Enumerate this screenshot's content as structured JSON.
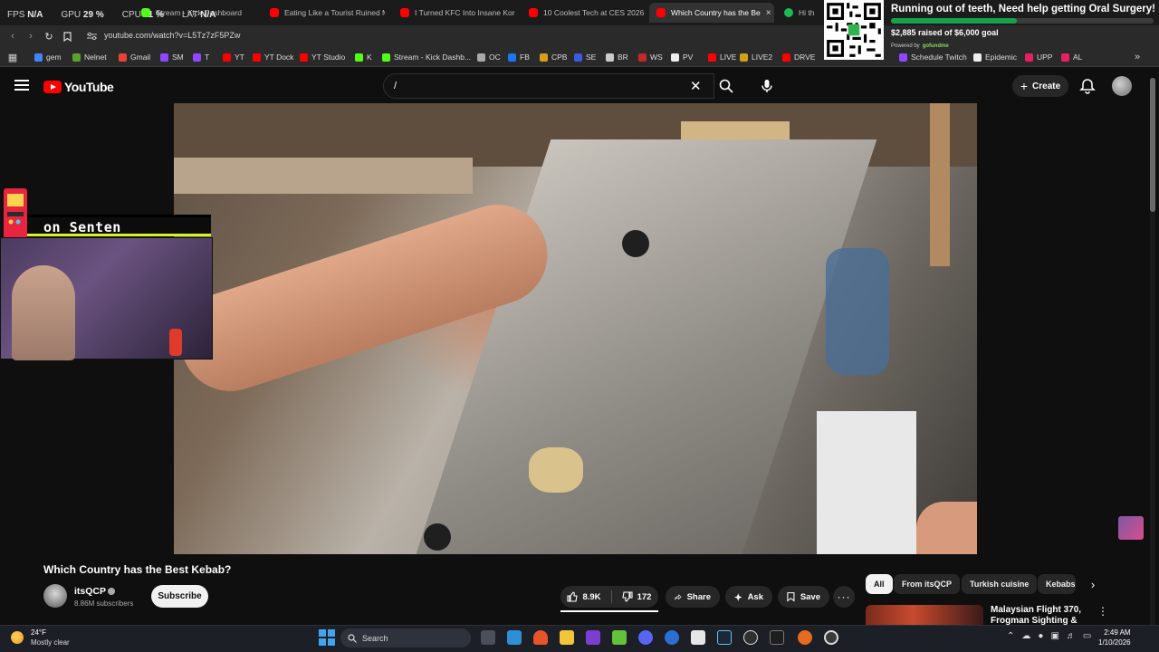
{
  "overlay": {
    "fps_label": "FPS",
    "fps_value": "N/A",
    "gpu_label": "GPU",
    "gpu_value": "29 %",
    "cpu_label": "CPU",
    "cpu_value": "11 %",
    "lat_label": "LAT",
    "lat_value": "N/A"
  },
  "tabs": [
    {
      "label": "Stream - Kick Dashboard",
      "color": "#53fc18"
    },
    {
      "label": "Eating Like a Tourist Ruined My",
      "color": "#ff0000"
    },
    {
      "label": "I Turned KFC Into Insane Korea",
      "color": "#ff0000"
    },
    {
      "label": "10 Coolest Tech at CES 2026 (",
      "color": "#ff0000"
    },
    {
      "label": "Which Country has the Be",
      "color": "#ff0000",
      "close": "×"
    },
    {
      "label": "Hi th",
      "color": "#1db954"
    }
  ],
  "address": {
    "url": "youtube.com/watch?v=L5Tz7zF5PZw"
  },
  "bookmarks": [
    {
      "label": "gem",
      "color": "#4285f4"
    },
    {
      "label": "Nelnet",
      "color": "#5aa02c"
    },
    {
      "label": "Gmail",
      "color": "#ea4335"
    },
    {
      "label": "SM",
      "color": "#9146ff"
    },
    {
      "label": "T",
      "color": "#9146ff"
    },
    {
      "label": "YT",
      "color": "#ff0000"
    },
    {
      "label": "YT Dock",
      "color": "#ff0000"
    },
    {
      "label": "YT Studio",
      "color": "#ff0000"
    },
    {
      "label": "K",
      "color": "#53fc18"
    },
    {
      "label": "Stream - Kick Dashb...",
      "color": "#53fc18"
    },
    {
      "label": "OC",
      "color": "#aaaaaa"
    },
    {
      "label": "FB",
      "color": "#1877f2"
    },
    {
      "label": "CPB",
      "color": "#d4a017"
    },
    {
      "label": "SE",
      "color": "#3b5bdb"
    },
    {
      "label": "BR",
      "color": "#cccccc"
    },
    {
      "label": "WS",
      "color": "#c62828"
    },
    {
      "label": "PV",
      "color": "#eeeeee"
    },
    {
      "label": "LIVE",
      "color": "#ff0000"
    },
    {
      "label": "LIVE2",
      "color": "#d4a017"
    },
    {
      "label": "DRVE",
      "color": "#ff0000"
    },
    {
      "label": "Schedule Twitch",
      "color": "#9146ff"
    },
    {
      "label": "Epidemic",
      "color": "#eeeeee"
    },
    {
      "label": "UPP",
      "color": "#e91e63"
    },
    {
      "label": "AL",
      "color": "#e91e63"
    }
  ],
  "gofundme": {
    "title": "Running out of teeth, Need help getting Oral Surgery!",
    "raised": "$2,885 raised of $6,000 goal",
    "progress": 0.48,
    "powered": "Powered by",
    "brand": "gofundme"
  },
  "youtube": {
    "logo": "YouTube",
    "search_value": "/",
    "create_label": "Create"
  },
  "webcam": {
    "banner": "on Senten"
  },
  "video": {
    "title": "Which Country has the Best Kebab?",
    "channel": "itsQCP",
    "subscribers": "8.86M subscribers",
    "subscribe_label": "Subscribe",
    "likes": "8.9K",
    "dislikes": "172",
    "share_label": "Share",
    "ask_label": "Ask",
    "save_label": "Save"
  },
  "chips": [
    {
      "label": "All",
      "selected": true
    },
    {
      "label": "From itsQCP",
      "selected": false
    },
    {
      "label": "Turkish cuisine",
      "selected": false
    },
    {
      "label": "Kebabs",
      "selected": false
    }
  ],
  "recommended": {
    "title": "Malaysian Flight 370, Frogman Sighting &"
  },
  "taskbar": {
    "temp": "24°F",
    "condition": "Mostly clear",
    "search_placeholder": "Search",
    "time": "2:49 AM",
    "date": "1/10/2026"
  }
}
